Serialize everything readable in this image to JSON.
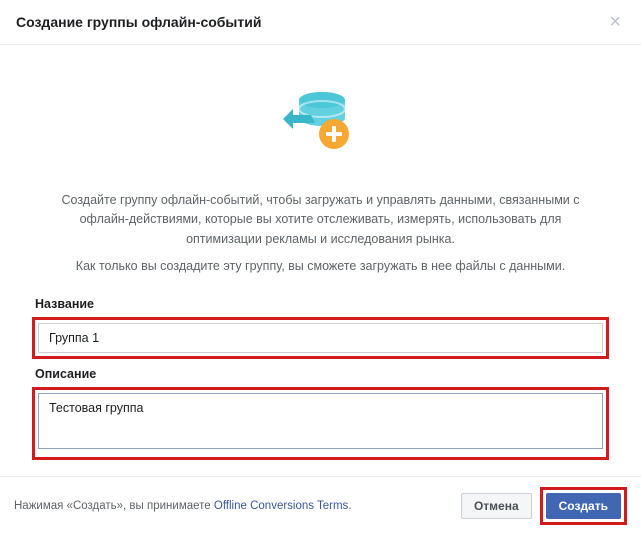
{
  "header": {
    "title": "Создание группы офлайн-событий"
  },
  "body": {
    "description1": "Создайте группу офлайн-событий, чтобы загружать и управлять данными, связанными с офлайн-действиями, которые вы хотите отслеживать, измерять, использовать для оптимизации рекламы и исследования рынка.",
    "description2": "Как только вы создадите эту группу, вы сможете загружать в нее файлы с данными."
  },
  "form": {
    "name_label": "Название",
    "name_value": "Группа 1",
    "desc_label": "Описание",
    "desc_value": "Тестовая группа"
  },
  "footer": {
    "terms_prefix": "Нажимая «Создать», вы принимаете ",
    "terms_link": "Offline Conversions Terms",
    "terms_suffix": ".",
    "cancel": "Отмена",
    "create": "Создать"
  },
  "colors": {
    "primary": "#4267b2",
    "highlight": "#d11b1f",
    "icon_cyan": "#4bc7d8",
    "icon_orange": "#f7a833"
  }
}
